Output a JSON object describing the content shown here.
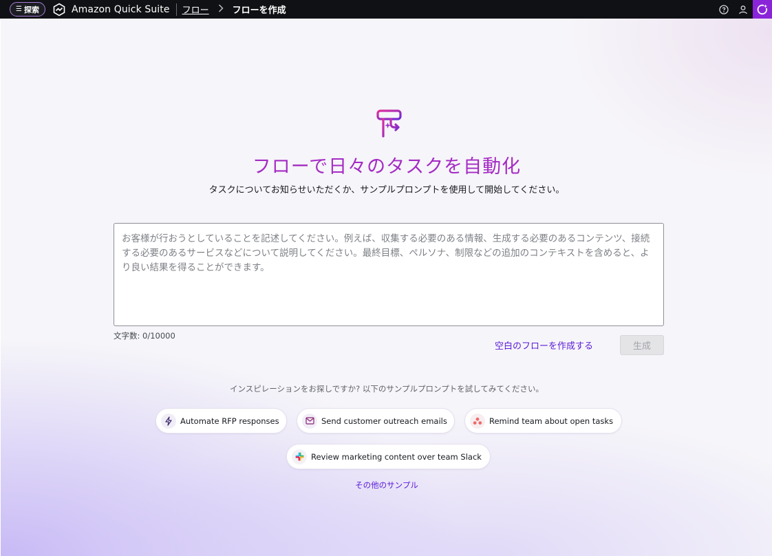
{
  "topbar": {
    "explore_label": "探索",
    "menu_icon": "menu-icon",
    "brand_name": "Amazon Quick Suite",
    "breadcrumb": {
      "parent": "フロー",
      "separator_icon": "chevron-right-icon",
      "current": "フローを作成"
    },
    "icons": [
      "help-icon",
      "user-icon",
      "assistant-icon"
    ]
  },
  "hero": {
    "icon": "flow-sparkle-icon",
    "title": "フローで日々のタスクを自動化",
    "subtitle": "タスクについてお知らせいただくか、サンプルプロンプトを使用して開始してください。"
  },
  "prompt": {
    "value": "",
    "placeholder": "お客様が行おうとしていることを記述してください。例えば、収集する必要のある情報、生成する必要のあるコンテンツ、接続する必要のあるサービスなどについて説明してください。最終目標、ペルソナ、制限などの追加のコンテキストを含めると、より良い結果を得ることができます。",
    "char_count": "文字数: 0/10000"
  },
  "actions": {
    "blank_flow": "空白のフローを作成する",
    "generate": "生成"
  },
  "inspiration": {
    "text": "インスピレーションをお探しですか? 以下のサンプルプロンプトを試してみてください。",
    "samples": [
      {
        "label": "Automate RFP responses",
        "icon": "lightning-icon"
      },
      {
        "label": "Send customer outreach emails",
        "icon": "mail-icon"
      },
      {
        "label": "Remind team about open tasks",
        "icon": "asana-icon"
      },
      {
        "label": "Review marketing content over team Slack",
        "icon": "slack-icon"
      }
    ],
    "more": "その他のサンプル"
  },
  "colors": {
    "accent": "#a42bc4",
    "link": "#5a1ad8",
    "topbar": "#0f1114",
    "assistant": "#8a24d8"
  }
}
